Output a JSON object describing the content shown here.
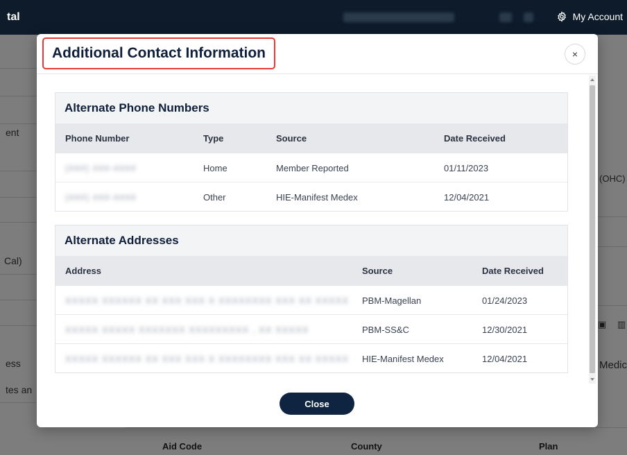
{
  "app": {
    "brand_fragment": "tal",
    "account_label": "My Account",
    "icons": [
      "gear-icon",
      "close-icon"
    ]
  },
  "background": {
    "left_fragments": [
      "ent",
      "Cal)",
      "ess",
      "tes an"
    ],
    "right_fragments": [
      "(OHC)",
      "Medic"
    ],
    "bottom_labels": [
      "Aid Code",
      "County",
      "Plan"
    ]
  },
  "modal": {
    "title": "Additional Contact Information",
    "close_x": "×",
    "close_button": "Close",
    "phones": {
      "title": "Alternate Phone Numbers",
      "columns": [
        "Phone Number",
        "Type",
        "Source",
        "Date Received"
      ],
      "rows": [
        {
          "phone": "(###) ###-####",
          "type": "Home",
          "source": "Member Reported",
          "date": "01/11/2023"
        },
        {
          "phone": "(###) ###-####",
          "type": "Other",
          "source": "HIE-Manifest Medex",
          "date": "12/04/2021"
        }
      ]
    },
    "addresses": {
      "title": "Alternate Addresses",
      "columns": [
        "Address",
        "Source",
        "Date Received"
      ],
      "rows": [
        {
          "address": "XXXXX XXXXXX XX XXX XXX X XXXXXXXX XXX XX XXXXX",
          "source": "PBM-Magellan",
          "date": "01/24/2023"
        },
        {
          "address": "XXXXX XXXXX XXXXXXX XXXXXXXXX , XX XXXXX",
          "source": "PBM-SS&C",
          "date": "12/30/2021"
        },
        {
          "address": "XXXXX XXXXXX XX XXX XXX X XXXXXXXX XXX XX XXXXX",
          "source": "HIE-Manifest Medex",
          "date": "12/04/2021"
        }
      ]
    }
  },
  "colors": {
    "topbar": "#0d1b2a",
    "title_highlight": "#e53935",
    "primary_button": "#0f2440"
  }
}
